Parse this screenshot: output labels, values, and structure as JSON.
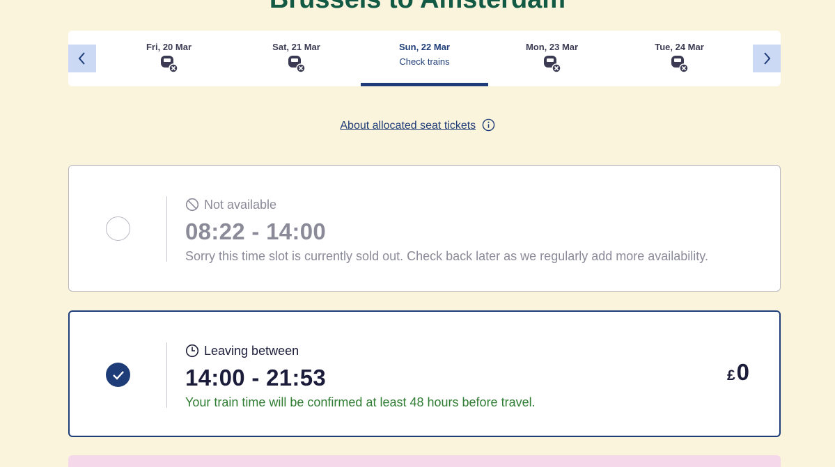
{
  "page_title": "Brussels to Amsterdam",
  "colors": {
    "background": "#fbf4dc",
    "title": "#125a44",
    "accent": "#1e3c78",
    "nav_button": "#cbd9f4",
    "success_text": "#2f7d32",
    "muted_text": "#8a8a98",
    "promo": "#f5d8ea"
  },
  "date_bar": {
    "prev_icon": "chevron-left-icon",
    "next_icon": "chevron-right-icon",
    "dates": [
      {
        "label": "Fri, 20 Mar",
        "status_icon": "no-trains-icon"
      },
      {
        "label": "Sat, 21 Mar",
        "status_icon": "no-trains-icon"
      },
      {
        "label": "Sun, 22 Mar",
        "sublabel": "Check trains",
        "active": true
      },
      {
        "label": "Mon, 23 Mar",
        "status_icon": "no-trains-icon"
      },
      {
        "label": "Tue, 24 Mar",
        "status_icon": "no-trains-icon"
      }
    ]
  },
  "about_link": {
    "label": "About allocated seat tickets",
    "icon": "info-icon"
  },
  "slots": [
    {
      "status": "Not available",
      "status_icon": "unavailable-icon",
      "time_range": "08:22 - 14:00",
      "description": "Sorry this time slot is currently sold out. Check back later as we regularly add more availability.",
      "selected": false
    },
    {
      "status": "Leaving between",
      "status_icon": "clock-icon",
      "time_range": "14:00 - 21:53",
      "description": "Your train time will be confirmed at least 48 hours before travel.",
      "currency": "£",
      "price": "0",
      "selected": true
    }
  ]
}
